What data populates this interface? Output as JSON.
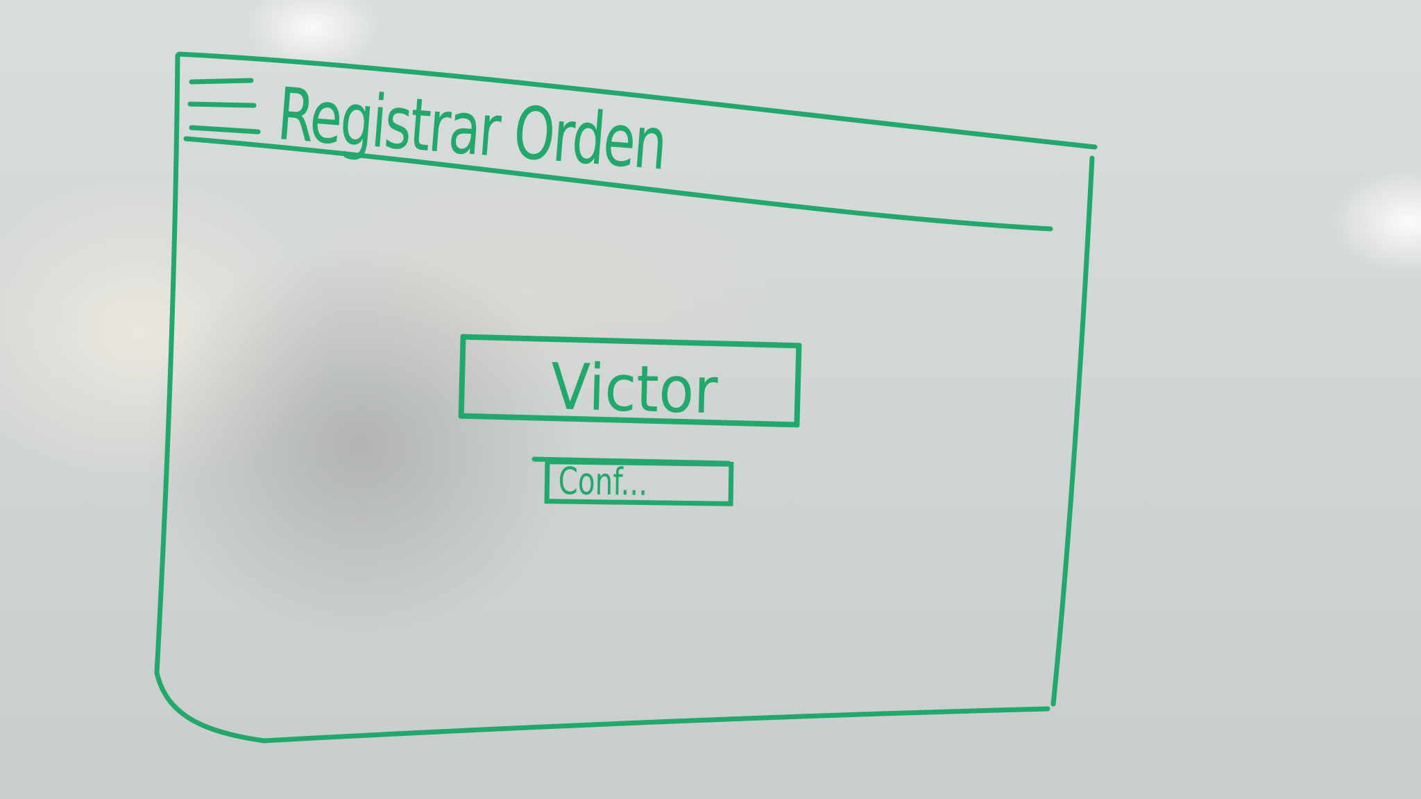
{
  "app": {
    "title": "Registrar Orden",
    "menu_icon": "hamburger-icon"
  },
  "form": {
    "name_value": "Victor",
    "confirm_label": "Conf..."
  },
  "colors": {
    "marker": "#22a86a",
    "board": "#d4d8d7"
  }
}
